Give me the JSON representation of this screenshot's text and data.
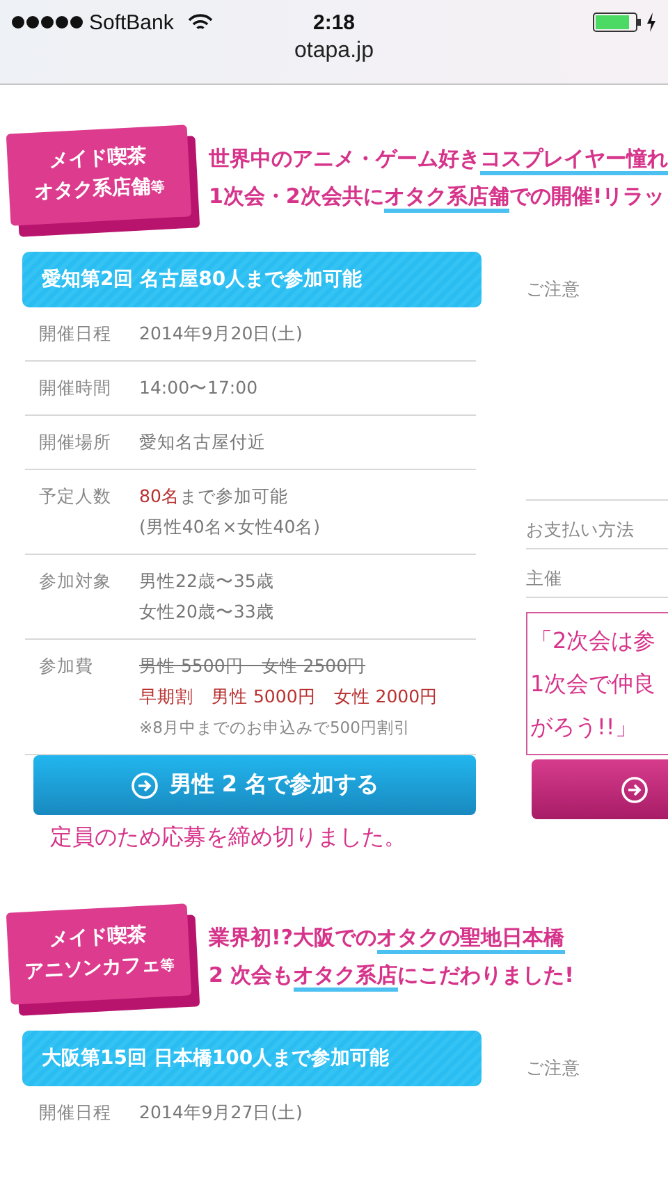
{
  "status_bar": {
    "carrier": "SoftBank",
    "time": "2:18"
  },
  "url": "otapa.jp",
  "events": [
    {
      "badge": [
        "メイド喫茶",
        "オタク系店舗"
      ],
      "badge_suffix": "等",
      "headline": [
        [
          {
            "text": "世界中のアニメ・ゲーム好き",
            "underlined": false
          },
          {
            "text": "コスプレイヤー憧れ",
            "underlined": true
          }
        ],
        [
          {
            "text": "1次会・2次会共に",
            "underlined": false
          },
          {
            "text": "オタク系店舗",
            "underlined": true
          },
          {
            "text": "での開催!リラッ",
            "underlined": false
          }
        ]
      ],
      "title": "愛知第2回 名古屋80人まで参加可能",
      "rows": [
        {
          "label": "開催日程",
          "lines": [
            [
              {
                "text": "2014年9月20日(土)",
                "kind": "plain"
              }
            ]
          ]
        },
        {
          "label": "開催時間",
          "lines": [
            [
              {
                "text": "14:00〜17:00",
                "kind": "plain"
              }
            ]
          ]
        },
        {
          "label": "開催場所",
          "lines": [
            [
              {
                "text": "愛知名古屋付近",
                "kind": "plain"
              }
            ]
          ]
        },
        {
          "label": "予定人数",
          "lines": [
            [
              {
                "text": "80名",
                "kind": "red"
              },
              {
                "text": "まで参加可能",
                "kind": "plain"
              }
            ],
            [
              {
                "text": "(男性40名×女性40名)",
                "kind": "plain"
              }
            ]
          ]
        },
        {
          "label": "参加対象",
          "lines": [
            [
              {
                "text": "男性22歳〜35歳",
                "kind": "plain"
              }
            ],
            [
              {
                "text": "女性20歳〜33歳",
                "kind": "plain"
              }
            ]
          ]
        },
        {
          "label": "参加費",
          "lines": [
            [
              {
                "text": "男性 5500円　女性 2500円",
                "kind": "strike"
              }
            ],
            [
              {
                "text": "早期割　男性 5000円　女性 2000円",
                "kind": "red"
              }
            ],
            [
              {
                "text": "※8月中までのお申込みで500円割引",
                "kind": "note"
              }
            ]
          ]
        }
      ],
      "signup_button": "男性 2 名で参加する",
      "closed_message": "定員のため応募を締め切りました。",
      "side": {
        "rows": [
          "ご注意",
          "お支払い方法",
          "主催"
        ],
        "quote_lines": [
          "「2次会は参",
          "1次会で仲良",
          "がろう!!」"
        ],
        "button": true
      }
    },
    {
      "badge": [
        "メイド喫茶",
        "アニソンカフェ"
      ],
      "badge_suffix": "等",
      "headline": [
        [
          {
            "text": "業界初!?大阪での",
            "underlined": false
          },
          {
            "text": "オタクの聖地日本橋",
            "underlined": true
          }
        ],
        [
          {
            "text": "2 次会も",
            "underlined": false
          },
          {
            "text": "オタク系店",
            "underlined": true
          },
          {
            "text": "にこだわりました!",
            "underlined": false
          }
        ]
      ],
      "title": "大阪第15回 日本橋100人まで参加可能",
      "rows": [
        {
          "label": "開催日程",
          "lines": [
            [
              {
                "text": "2014年9月27日(土)",
                "kind": "plain"
              }
            ]
          ]
        }
      ],
      "side": {
        "rows": [
          "ご注意"
        ]
      }
    }
  ]
}
